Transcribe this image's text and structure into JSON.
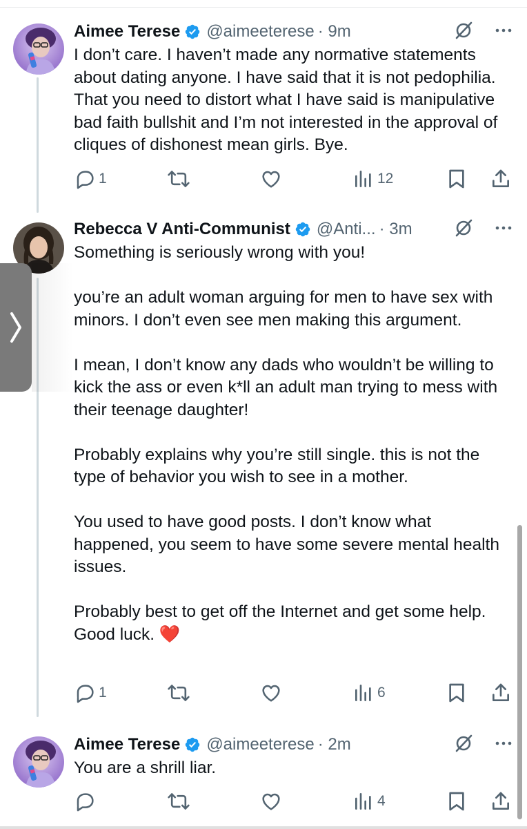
{
  "tweets": [
    {
      "author": "Aimee Terese",
      "handle": "@aimeeterese",
      "time": "· 9m",
      "avatar": "avatar-aimee",
      "text": "I don’t care. I haven’t made any normative statements about dating anyone. I have said that it is not pedophilia. That you need to distort what I have said is manipulative bad faith bullshit and I’m not interested in the approval of cliques of dishonest mean girls. Bye.",
      "replies": "1",
      "retweets": "",
      "likes": "",
      "views": "12"
    },
    {
      "author": "Rebecca V Anti-Communist",
      "handle": "@Anti...",
      "time": "· 3m",
      "avatar": "avatar-rebecca",
      "text": "Something is seriously wrong with you!\n\nyou’re an adult woman arguing for men to have sex with minors. I don’t even see men making this argument.\n\nI mean, I don’t know any dads who wouldn’t be willing to kick the ass or even k*ll an adult man trying to mess with their teenage daughter!\n\nProbably explains why you’re still single. this is not the type of behavior you wish to see in a mother.\n\nYou used to have good posts. I don’t know what happened, you seem to have some severe mental health issues.\n\nProbably best to get off the Internet and get some help. Good luck. ❤️",
      "replies": "1",
      "retweets": "",
      "likes": "",
      "views": "6"
    },
    {
      "author": "Aimee Terese",
      "handle": "@aimeeterese",
      "time": "· 2m",
      "avatar": "avatar-aimee",
      "text": "You are a shrill liar.",
      "replies": "",
      "retweets": "",
      "likes": "",
      "views": "4"
    }
  ],
  "colors": {
    "verified": "#1d9bf0",
    "text": "#0f1419",
    "secondary": "#536471",
    "heart": "#e0245e"
  },
  "icons": [
    "verified-badge-icon",
    "grok-icon",
    "more-icon",
    "reply-icon",
    "retweet-icon",
    "like-icon",
    "views-icon",
    "bookmark-icon",
    "share-icon",
    "chevron-right-icon"
  ]
}
